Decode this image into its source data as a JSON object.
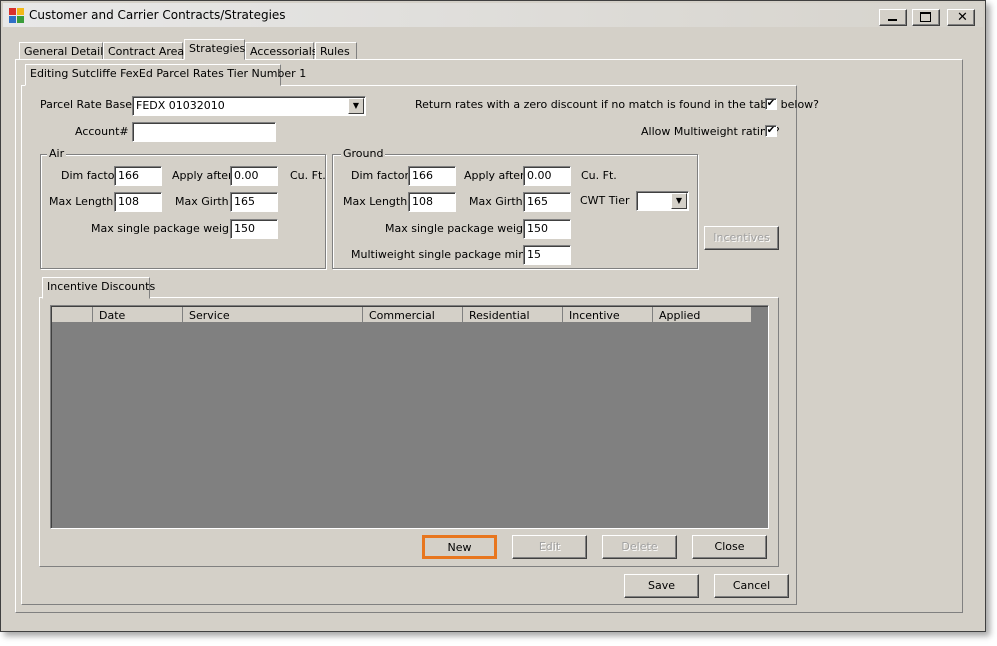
{
  "window": {
    "title": "Customer and Carrier Contracts/Strategies"
  },
  "tabs": [
    "General Details",
    "Contract Areas",
    "Strategies",
    "Accessorials",
    "Rules"
  ],
  "subtab": "Editing Sutcliffe FexEd Parcel Rates Tier Number 1",
  "form": {
    "parcel_rate_base_label": "Parcel Rate Base",
    "parcel_rate_base_value": "FEDX 01032010",
    "account_label": "Account#",
    "account_value": "",
    "zero_discount_label": "Return rates with a zero discount if no match is found in the table below?",
    "zero_discount_checked": true,
    "multiweight_label": "Allow Multiweight rating?",
    "multiweight_checked": true
  },
  "air": {
    "title": "Air",
    "dim_factor_label": "Dim factor",
    "dim_factor": "166",
    "apply_after_label": "Apply after",
    "apply_after": "0.00",
    "cuft_label": "Cu. Ft.",
    "max_length_label": "Max Length",
    "max_length": "108",
    "max_girth_label": "Max Girth",
    "max_girth": "165",
    "max_single_label": "Max single package weight",
    "max_single": "150"
  },
  "ground": {
    "title": "Ground",
    "dim_factor_label": "Dim factor",
    "dim_factor": "166",
    "apply_after_label": "Apply after",
    "apply_after": "0.00",
    "cuft_label": "Cu. Ft.",
    "max_length_label": "Max Length",
    "max_length": "108",
    "max_girth_label": "Max Girth",
    "max_girth": "165",
    "cwt_tier_label": "CWT Tier",
    "cwt_tier": "",
    "max_single_label": "Max single package weight",
    "max_single": "150",
    "multiweight_min_label": "Multiweight single package min.wt.",
    "multiweight_min": "15"
  },
  "incentives_button": "Incentives",
  "incentive_tab": "Incentive Discounts",
  "grid": {
    "columns": [
      "Date",
      "Service",
      "Commercial",
      "Residential",
      "Incentive",
      "Applied"
    ]
  },
  "buttons": {
    "new": "New",
    "edit": "Edit",
    "delete": "Delete",
    "close": "Close",
    "save": "Save",
    "cancel": "Cancel"
  },
  "colors": {
    "highlight": "#e8761e",
    "grid_bg": "#808080"
  },
  "icons": {
    "app": "app-icon",
    "minimize": "minimize-icon",
    "maximize": "maximize-icon",
    "close": "close-icon",
    "dropdown": "chevron-down-icon",
    "check": "check-icon"
  }
}
